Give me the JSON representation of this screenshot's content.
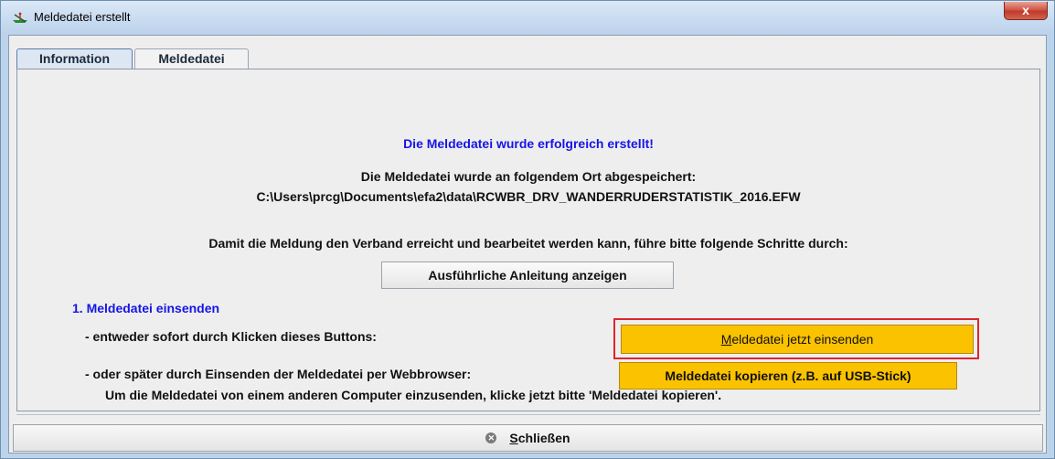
{
  "window": {
    "title": "Meldedatei erstellt",
    "close_glyph": "x"
  },
  "tabs": [
    {
      "label": "Information",
      "active": true
    },
    {
      "label": "Meldedatei",
      "active": false
    }
  ],
  "content": {
    "success_message": "Die Meldedatei wurde erfolgreich erstellt!",
    "saved_location_label": "Die Meldedatei wurde an folgendem Ort abgespeichert:",
    "file_path": "C:\\Users\\prcg\\Documents\\efa2\\data\\RCWBR_DRV_WANDERRUDERSTATISTIK_2016.EFW",
    "steps_intro": "Damit die Meldung den Verband erreicht und bearbeitet werden kann, führe bitte folgende Schritte durch:",
    "instructions_button": "Ausführliche Anleitung anzeigen",
    "step1_heading": "1. Meldedatei einsenden",
    "option_now": "- entweder sofort durch Klicken dieses Buttons:",
    "send_button_mnemonic": "M",
    "send_button_rest": "eldedatei jetzt einsenden",
    "option_later": "- oder später durch Einsenden der Meldedatei per Webbrowser:",
    "copy_button": "Meldedatei kopieren (z.B. auf USB-Stick)",
    "other_computer_note": "Um die Meldedatei von einem anderen Computer einzusenden, klicke jetzt bitte 'Meldedatei kopieren'."
  },
  "footer": {
    "close_icon": "close-circle-icon",
    "close_mnemonic": "S",
    "close_rest": "chließen"
  },
  "colors": {
    "accent_blue": "#1515e6",
    "button_yellow": "#fbc200",
    "highlight_red": "#e0242d"
  }
}
